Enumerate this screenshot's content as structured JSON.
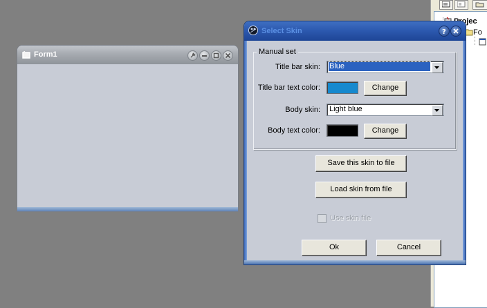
{
  "ide": {
    "tree_items": [
      "Projec",
      "Fo"
    ]
  },
  "form1": {
    "title": "Form1"
  },
  "dialog": {
    "title": "Select Skin",
    "group_label": "Manual set",
    "title_bar_skin": {
      "label": "Title bar skin:",
      "value": "Blue"
    },
    "title_bar_text_color": {
      "label": "Title bar text color:",
      "color": "#1689ce",
      "button": "Change"
    },
    "body_skin": {
      "label": "Body skin:",
      "value": "Light blue"
    },
    "body_text_color": {
      "label": "Body text color:",
      "color": "#000000",
      "button": "Change"
    },
    "save_button": "Save this skin to file",
    "load_button": "Load skin from file",
    "use_skin_file": {
      "label": "Use skin file",
      "checked": false,
      "enabled": false
    },
    "ok_button": "Ok",
    "cancel_button": "Cancel"
  },
  "colors": {
    "desktop": "#808080",
    "dialog_title": "#2d5ab0",
    "body": "#c8ccd6"
  }
}
